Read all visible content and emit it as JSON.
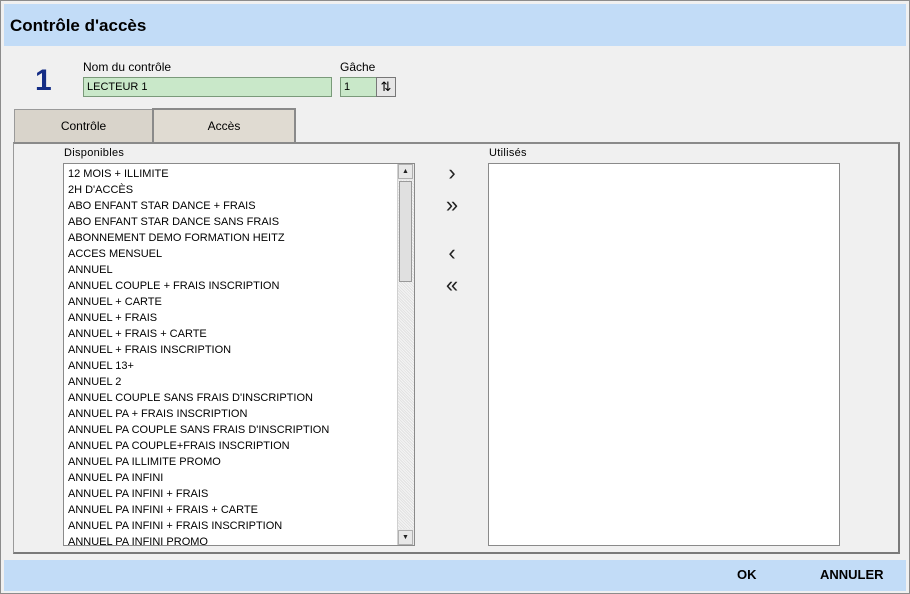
{
  "window": {
    "title": "Contrôle d'accès"
  },
  "header": {
    "number": "1",
    "name_label": "Nom du contrôle",
    "name_value": "LECTEUR 1",
    "gache_label": "Gâche",
    "gache_value": "1",
    "spinner_icon": "spin-updown-icon"
  },
  "tabs": [
    {
      "label": "Contrôle",
      "active": false
    },
    {
      "label": "Accès",
      "active": true
    }
  ],
  "available": {
    "label": "Disponibles",
    "items": [
      "12 MOIS + ILLIMITE",
      "2H D'ACCÈS",
      "ABO ENFANT STAR DANCE + FRAIS",
      "ABO ENFANT STAR DANCE SANS FRAIS",
      "ABONNEMENT DEMO FORMATION HEITZ",
      "ACCES MENSUEL",
      "ANNUEL",
      "ANNUEL  COUPLE + FRAIS INSCRIPTION",
      "ANNUEL + CARTE",
      "ANNUEL + FRAIS",
      "ANNUEL + FRAIS + CARTE",
      "ANNUEL + FRAIS INSCRIPTION",
      "ANNUEL 13+",
      "ANNUEL 2",
      "ANNUEL COUPLE SANS FRAIS D'INSCRIPTION",
      "ANNUEL PA + FRAIS INSCRIPTION",
      "ANNUEL PA COUPLE SANS FRAIS D'INSCRIPTION",
      "ANNUEL PA COUPLE+FRAIS INSCRIPTION",
      "ANNUEL PA ILLIMITE PROMO",
      "ANNUEL PA INFINI",
      "ANNUEL PA INFINI + FRAIS",
      "ANNUEL PA INFINI + FRAIS + CARTE",
      "ANNUEL PA INFINI + FRAIS INSCRIPTION",
      "ANNUEL PA INFINI PROMO"
    ]
  },
  "used": {
    "label": "Utilisés",
    "items": []
  },
  "move_buttons": {
    "add_one": "›",
    "add_all": "»",
    "remove_one": "‹",
    "remove_all": "«"
  },
  "footer": {
    "ok_label": "OK",
    "cancel_label": "ANNULER"
  },
  "colors": {
    "titlebar": "#c2dcf7",
    "field_bg": "#c9e8c9",
    "number": "#142d86"
  }
}
